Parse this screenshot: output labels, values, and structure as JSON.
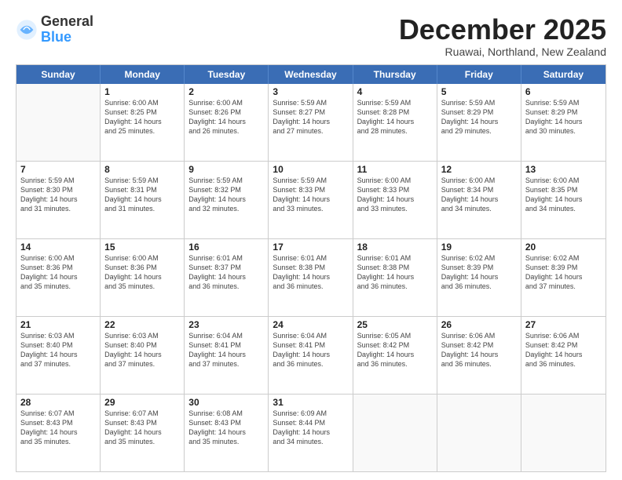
{
  "logo": {
    "general": "General",
    "blue": "Blue"
  },
  "title": "December 2025",
  "subtitle": "Ruawai, Northland, New Zealand",
  "header_days": [
    "Sunday",
    "Monday",
    "Tuesday",
    "Wednesday",
    "Thursday",
    "Friday",
    "Saturday"
  ],
  "rows": [
    [
      {
        "day": "",
        "info": ""
      },
      {
        "day": "1",
        "info": "Sunrise: 6:00 AM\nSunset: 8:25 PM\nDaylight: 14 hours\nand 25 minutes."
      },
      {
        "day": "2",
        "info": "Sunrise: 6:00 AM\nSunset: 8:26 PM\nDaylight: 14 hours\nand 26 minutes."
      },
      {
        "day": "3",
        "info": "Sunrise: 5:59 AM\nSunset: 8:27 PM\nDaylight: 14 hours\nand 27 minutes."
      },
      {
        "day": "4",
        "info": "Sunrise: 5:59 AM\nSunset: 8:28 PM\nDaylight: 14 hours\nand 28 minutes."
      },
      {
        "day": "5",
        "info": "Sunrise: 5:59 AM\nSunset: 8:29 PM\nDaylight: 14 hours\nand 29 minutes."
      },
      {
        "day": "6",
        "info": "Sunrise: 5:59 AM\nSunset: 8:29 PM\nDaylight: 14 hours\nand 30 minutes."
      }
    ],
    [
      {
        "day": "7",
        "info": "Sunrise: 5:59 AM\nSunset: 8:30 PM\nDaylight: 14 hours\nand 31 minutes."
      },
      {
        "day": "8",
        "info": "Sunrise: 5:59 AM\nSunset: 8:31 PM\nDaylight: 14 hours\nand 31 minutes."
      },
      {
        "day": "9",
        "info": "Sunrise: 5:59 AM\nSunset: 8:32 PM\nDaylight: 14 hours\nand 32 minutes."
      },
      {
        "day": "10",
        "info": "Sunrise: 5:59 AM\nSunset: 8:33 PM\nDaylight: 14 hours\nand 33 minutes."
      },
      {
        "day": "11",
        "info": "Sunrise: 6:00 AM\nSunset: 8:33 PM\nDaylight: 14 hours\nand 33 minutes."
      },
      {
        "day": "12",
        "info": "Sunrise: 6:00 AM\nSunset: 8:34 PM\nDaylight: 14 hours\nand 34 minutes."
      },
      {
        "day": "13",
        "info": "Sunrise: 6:00 AM\nSunset: 8:35 PM\nDaylight: 14 hours\nand 34 minutes."
      }
    ],
    [
      {
        "day": "14",
        "info": "Sunrise: 6:00 AM\nSunset: 8:36 PM\nDaylight: 14 hours\nand 35 minutes."
      },
      {
        "day": "15",
        "info": "Sunrise: 6:00 AM\nSunset: 8:36 PM\nDaylight: 14 hours\nand 35 minutes."
      },
      {
        "day": "16",
        "info": "Sunrise: 6:01 AM\nSunset: 8:37 PM\nDaylight: 14 hours\nand 36 minutes."
      },
      {
        "day": "17",
        "info": "Sunrise: 6:01 AM\nSunset: 8:38 PM\nDaylight: 14 hours\nand 36 minutes."
      },
      {
        "day": "18",
        "info": "Sunrise: 6:01 AM\nSunset: 8:38 PM\nDaylight: 14 hours\nand 36 minutes."
      },
      {
        "day": "19",
        "info": "Sunrise: 6:02 AM\nSunset: 8:39 PM\nDaylight: 14 hours\nand 36 minutes."
      },
      {
        "day": "20",
        "info": "Sunrise: 6:02 AM\nSunset: 8:39 PM\nDaylight: 14 hours\nand 37 minutes."
      }
    ],
    [
      {
        "day": "21",
        "info": "Sunrise: 6:03 AM\nSunset: 8:40 PM\nDaylight: 14 hours\nand 37 minutes."
      },
      {
        "day": "22",
        "info": "Sunrise: 6:03 AM\nSunset: 8:40 PM\nDaylight: 14 hours\nand 37 minutes."
      },
      {
        "day": "23",
        "info": "Sunrise: 6:04 AM\nSunset: 8:41 PM\nDaylight: 14 hours\nand 37 minutes."
      },
      {
        "day": "24",
        "info": "Sunrise: 6:04 AM\nSunset: 8:41 PM\nDaylight: 14 hours\nand 36 minutes."
      },
      {
        "day": "25",
        "info": "Sunrise: 6:05 AM\nSunset: 8:42 PM\nDaylight: 14 hours\nand 36 minutes."
      },
      {
        "day": "26",
        "info": "Sunrise: 6:06 AM\nSunset: 8:42 PM\nDaylight: 14 hours\nand 36 minutes."
      },
      {
        "day": "27",
        "info": "Sunrise: 6:06 AM\nSunset: 8:42 PM\nDaylight: 14 hours\nand 36 minutes."
      }
    ],
    [
      {
        "day": "28",
        "info": "Sunrise: 6:07 AM\nSunset: 8:43 PM\nDaylight: 14 hours\nand 35 minutes."
      },
      {
        "day": "29",
        "info": "Sunrise: 6:07 AM\nSunset: 8:43 PM\nDaylight: 14 hours\nand 35 minutes."
      },
      {
        "day": "30",
        "info": "Sunrise: 6:08 AM\nSunset: 8:43 PM\nDaylight: 14 hours\nand 35 minutes."
      },
      {
        "day": "31",
        "info": "Sunrise: 6:09 AM\nSunset: 8:44 PM\nDaylight: 14 hours\nand 34 minutes."
      },
      {
        "day": "",
        "info": ""
      },
      {
        "day": "",
        "info": ""
      },
      {
        "day": "",
        "info": ""
      }
    ]
  ]
}
